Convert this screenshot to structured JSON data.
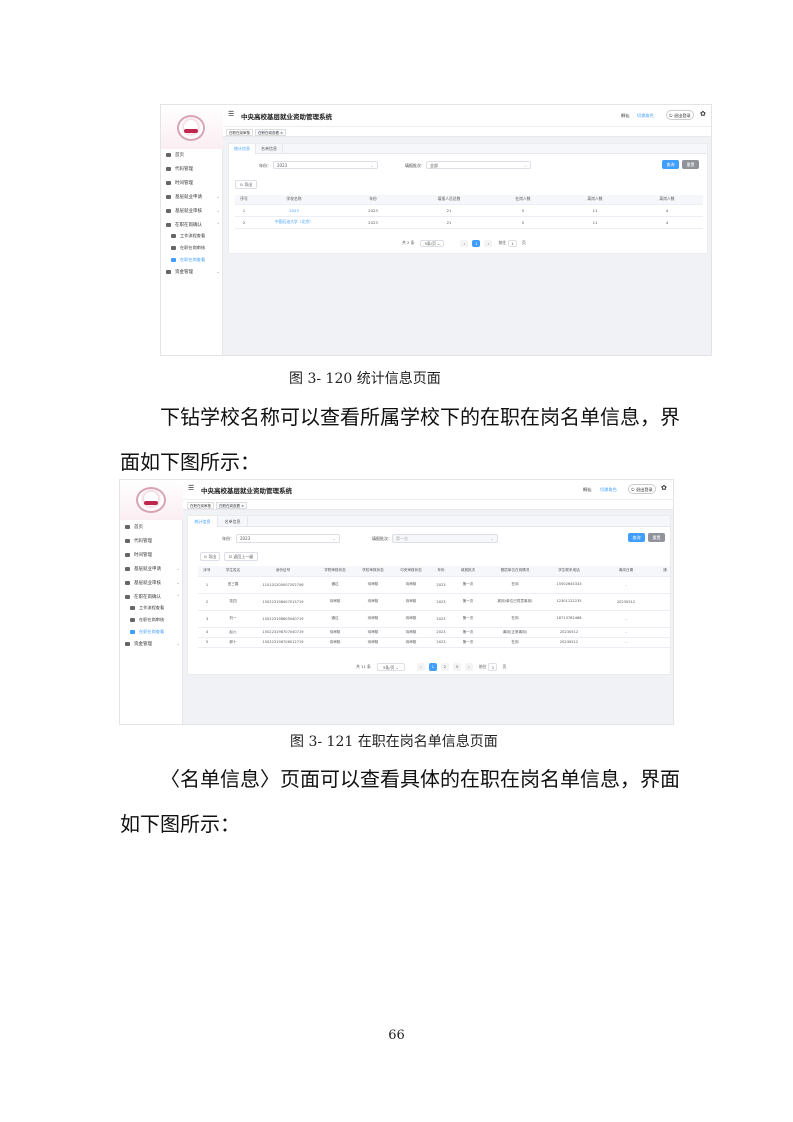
{
  "screenshot1": {
    "app_title": "中央高校基层就业资助管理系统",
    "header_right": [
      "桐仙",
      "切换角色"
    ],
    "logout_label": "退出登录",
    "page_tabs": [
      "在职在岗审核",
      "在职在岗查看"
    ],
    "menu": [
      "首页",
      "代码管理",
      "时间管理",
      "基层就业申请",
      "基层就业审核",
      "在职在岗确认",
      "工作流程查看",
      "在职在岗审核",
      "在职在岗查看",
      "资金管理"
    ],
    "content_tabs": [
      "统计信息",
      "名单信息"
    ],
    "filters": {
      "year_label": "年份：",
      "year_value": "2023",
      "batch_label": "填报批次：",
      "batch_value": "全部"
    },
    "buttons": {
      "search": "查询",
      "reset": "重置",
      "export": "导出"
    },
    "table": {
      "headers": [
        "序号",
        "学校名称",
        "年份",
        "填报人员总数",
        "在岗人数",
        "离岗人数",
        "离岗人数"
      ],
      "rows": [
        [
          "1",
          "2023",
          "2023",
          "21",
          "5",
          "11",
          "4"
        ],
        [
          "2",
          "中国石油大学（北京）",
          "2023",
          "21",
          "5",
          "11",
          "4"
        ]
      ]
    },
    "pager": {
      "total": "共 2 条",
      "size": "5条/页",
      "page": "1",
      "goto": "前往",
      "goto_value": "1",
      "goto_suffix": "页"
    }
  },
  "caption1": "图 3- 120 统计信息页面",
  "paragraph1": "下钻学校名称可以查看所属学校下的在职在岗名单信息，界面如下图所示：",
  "screenshot2": {
    "app_title": "中央高校基层就业资助管理系统",
    "header_right": [
      "桐仙",
      "切换角色"
    ],
    "logout_label": "退出登录",
    "page_tabs": [
      "在职在岗审核",
      "在职在岗查看"
    ],
    "menu": [
      "首页",
      "代码管理",
      "时间管理",
      "基层就业申请",
      "基层就业审核",
      "在职在岗确认",
      "工作流程查看",
      "在职在岗审核",
      "在职在岗查看",
      "资金管理"
    ],
    "content_tabs": [
      "统计信息",
      "名单信息"
    ],
    "filters": {
      "year_label": "年份：",
      "year_value": "2023",
      "batch_label": "填报批次：",
      "batch_value": "第一次"
    },
    "buttons": {
      "search": "查询",
      "reset": "重置",
      "export": "导出",
      "back": "返回上一级"
    },
    "table": {
      "headers": [
        "序号",
        "学生姓名",
        "身份证号",
        "学院审核状态",
        "学校审核状态",
        "中央审核状态",
        "年份",
        "填报批次",
        "基层单位在岗情况",
        "学生联系电话",
        "离岗日期",
        "操"
      ],
      "rows": [
        [
          "1",
          "田三展",
          "110101200007202706",
          "通过",
          "待审核",
          "待审核",
          "2023",
          "第一次",
          "在岗",
          "15502645333",
          "-"
        ],
        [
          "2",
          "张四",
          "150223198407015719",
          "待审核",
          "待审核",
          "待审核",
          "2023",
          "第一次",
          "离岗(单位已同意离岗)",
          "12301122235",
          "20230512"
        ],
        [
          "3",
          "刘一",
          "150223198605040719",
          "通过",
          "待审核",
          "待审核",
          "2023",
          "第一次",
          "在岗",
          "18713782468",
          "-"
        ],
        [
          "4",
          "赵六",
          "150223198707040719",
          "待审核",
          "待审核",
          "待审核",
          "2023",
          "第一次",
          "离岗(正常离岗)",
          "20230512",
          "-"
        ],
        [
          "5",
          "郝十",
          "150223198706012719",
          "待审核",
          "待审核",
          "待审核",
          "2023",
          "第一次",
          "在岗",
          "20230512",
          "-"
        ]
      ]
    },
    "pager": {
      "total": "共 11 条",
      "size": "5条/页",
      "pages": [
        "1",
        "2",
        "3"
      ],
      "goto": "前往",
      "goto_value": "1",
      "goto_suffix": "页"
    }
  },
  "caption2": "图 3- 121 在职在岗名单信息页面",
  "paragraph2": "〈名单信息〉页面可以查看具体的在职在岗名单信息，界面如下图所示：",
  "page_number": "66"
}
